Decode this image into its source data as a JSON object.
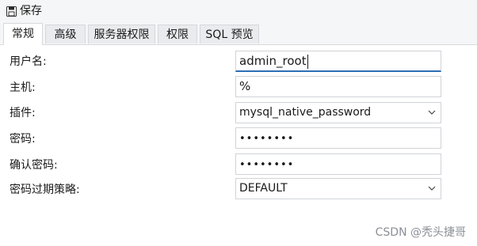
{
  "toolbar": {
    "save_label": "保存",
    "save_icon": "save-icon"
  },
  "tabs": [
    {
      "label": "常规",
      "active": true
    },
    {
      "label": "高级",
      "active": false
    },
    {
      "label": "服务器权限",
      "active": false
    },
    {
      "label": "权限",
      "active": false
    },
    {
      "label": "SQL 预览",
      "active": false
    }
  ],
  "form": {
    "username": {
      "label": "用户名:",
      "value": "admin_root"
    },
    "host": {
      "label": "主机:",
      "value": "%"
    },
    "plugin": {
      "label": "插件:",
      "value": "mysql_native_password"
    },
    "password": {
      "label": "密码:",
      "value": "••••••••"
    },
    "confirm_password": {
      "label": "确认密码:",
      "value": "••••••••"
    },
    "password_policy": {
      "label": "密码过期策略:",
      "value": "DEFAULT"
    }
  },
  "watermark": "CSDN @秃头捷哥",
  "colors": {
    "accent": "#2d6db5",
    "tab_inactive": "#e9ebee",
    "border": "#d0d3d8"
  }
}
